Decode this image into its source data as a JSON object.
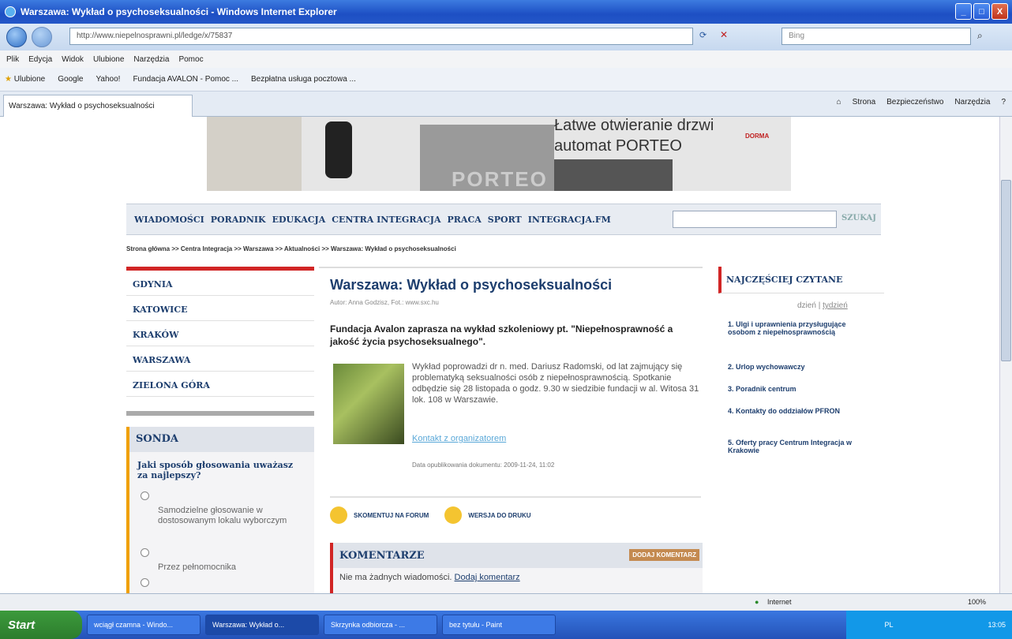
{
  "window": {
    "title": "Warszawa: Wykład o psychoseksualności - Windows Internet Explorer",
    "minimize": "_",
    "maximize": "□",
    "close": "X"
  },
  "toolbar": {
    "address": "http://www.niepelnosprawni.pl/ledge/x/75837",
    "search_placeholder": "Bing"
  },
  "menu": [
    "Plik",
    "Edycja",
    "Widok",
    "Ulubione",
    "Narzędzia",
    "Pomoc"
  ],
  "favorites": {
    "label": "Ulubione",
    "items": [
      "Google",
      "Yahoo!",
      "Fundacja AVALON - Pomoc ...",
      "Bezpłatna usługa pocztowa ..."
    ]
  },
  "tab": {
    "title": "Warszawa: Wykład o psychoseksualności"
  },
  "commands": [
    "Strona",
    "Bezpieczeństwo",
    "Narzędzia"
  ],
  "banner": {
    "headline": "Łatwe otwieranie drzwi",
    "subhead": "automat PORTEO",
    "brand": "DORMA",
    "product": "PORTEO"
  },
  "nav": {
    "items": [
      "WIADOMOŚCI",
      "PORADNIK",
      "EDUKACJA",
      "CENTRA INTEGRACJA",
      "PRACA",
      "SPORT",
      "INTEGRACJA.FM"
    ],
    "search_button": "SZUKAJ"
  },
  "breadcrumb": "Strona główna >> Centra Integracja >> Warszawa >> Aktualności >> Warszawa: Wykład o psychoseksualności",
  "cities": [
    "GDYNIA",
    "KATOWICE",
    "KRAKÓW",
    "WARSZAWA",
    "ZIELONA GÓRA"
  ],
  "sonda": {
    "title": "SONDA",
    "question": "Jaki sposób głosowania uważasz za najlepszy?",
    "options": [
      "Samodzielne głosowanie w dostosowanym lokalu wyborczym",
      "Przez pełnomocnika"
    ]
  },
  "article": {
    "title": "Warszawa: Wykład o psychoseksualności",
    "byline": "Autor: Anna Godzisz, Fot.: www.sxc.hu",
    "lead": "Fundacja Avalon zaprasza na wykład szkoleniowy pt. \"Niepełnosprawność a jakość życia psychoseksualnego\".",
    "body": "Wykład poprowadzi dr n. med. Dariusz Radomski, od lat zajmujący się problematyką seksualności osób z niepełnosprawnością. Spotkanie odbędzie się 28 listopada o godz. 9.30 w siedzibie fundacji w al. Witosa 31 lok. 108 w Warszawie.",
    "contact": "Kontakt z organizatorem",
    "pubdate": "Data opublikowania dokumentu: 2009-11-24, 11:02",
    "forum": "SKOMENTUJ NA FORUM",
    "print": "WERSJA DO DRUKU"
  },
  "comments": {
    "title": "KOMENTARZE",
    "add": "DODAJ KOMENTARZ",
    "none": "Nie ma żadnych wiadomości.",
    "add_link": "Dodaj komentarz"
  },
  "popular": {
    "title": "NAJCZĘŚCIEJ CZYTANE",
    "period_day": "dzień",
    "period_sep": "|",
    "period_week": "tydzień",
    "items": [
      "1. Ulgi i uprawnienia przysługujące osobom z niepełnosprawnością",
      "2. Urlop wychowawczy",
      "3. Poradnik centrum",
      "4. Kontakty do oddziałów PFRON",
      "5. Oferty pracy Centrum Integracja w Krakowie"
    ]
  },
  "status": {
    "zone": "Internet",
    "zoom": "100%"
  },
  "taskbar": {
    "start": "Start",
    "items": [
      "wciągł czamna - Windo...",
      "Warszawa: Wykład o...",
      "Skrzynka odbiorcza - ...",
      "bez tytułu - Paint"
    ],
    "lang": "PL",
    "clock": "13:05"
  },
  "colors": {
    "accent_red": "#d12525",
    "nav_blue": "#1d3e6e",
    "sonda_orange": "#f0a000"
  }
}
